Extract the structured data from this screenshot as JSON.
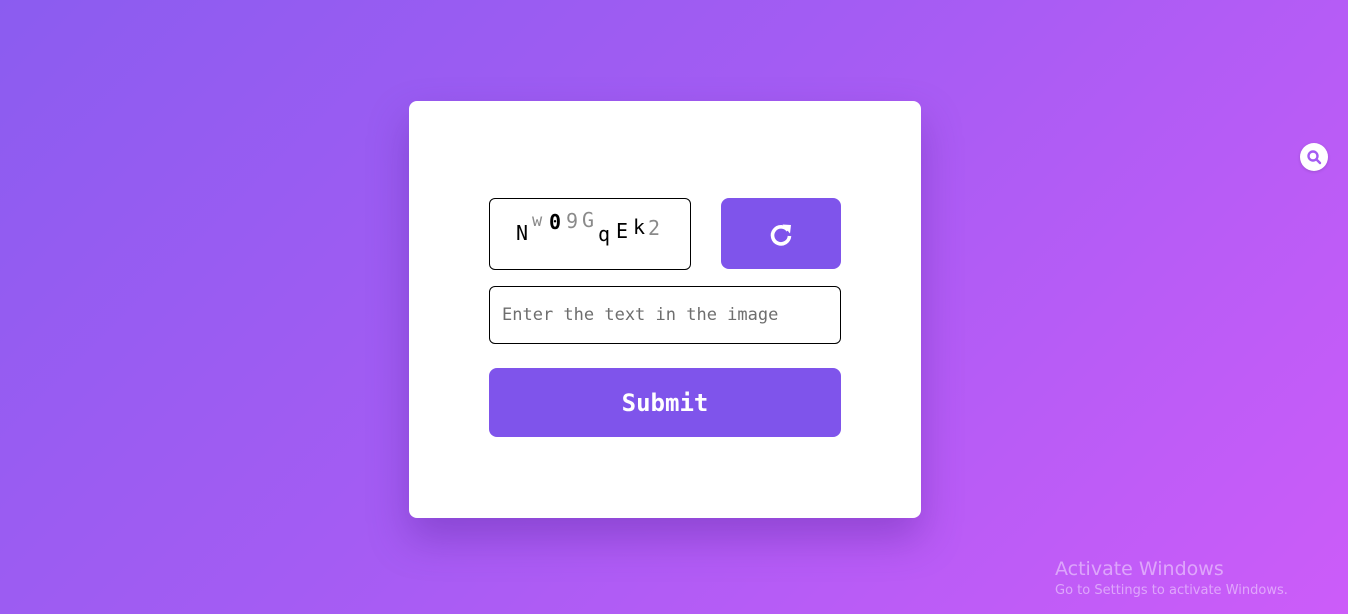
{
  "captcha": {
    "chars": [
      {
        "char": "N",
        "color": "#000000"
      },
      {
        "char": "w",
        "color": "#8a8a8a"
      },
      {
        "char": "0",
        "color": "#000000"
      },
      {
        "char": "9",
        "color": "#8a8a8a"
      },
      {
        "char": "G",
        "color": "#8a8a8a"
      },
      {
        "char": "q",
        "color": "#000000"
      },
      {
        "char": "E",
        "color": "#000000"
      },
      {
        "char": "k",
        "color": "#000000"
      },
      {
        "char": "2",
        "color": "#8a8a8a"
      }
    ],
    "refresh_icon": "refresh-icon"
  },
  "form": {
    "input_placeholder": "Enter the text in the image",
    "input_value": "",
    "submit_label": "Submit"
  },
  "extension": {
    "icon": "extension-search-icon"
  },
  "watermark": {
    "title": "Activate Windows",
    "subtitle": "Go to Settings to activate Windows."
  },
  "colors": {
    "accent": "#7f54eb",
    "background_start": "#8b5cf0",
    "background_end": "#cc5cf9",
    "card": "#ffffff"
  }
}
